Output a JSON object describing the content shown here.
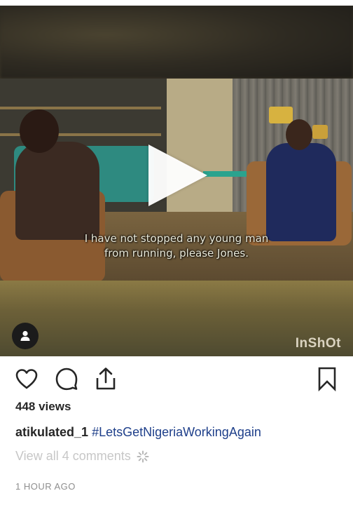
{
  "post": {
    "video": {
      "subtitle_line1": "I have not stopped any young man",
      "subtitle_line2": "from running, please Jones.",
      "watermark": "InShOt"
    },
    "views": "448 views",
    "caption": {
      "username": "atikulated_1",
      "hashtag": "#LetsGetNigeriaWorkingAgain"
    },
    "comments_link": "View all 4 comments",
    "timestamp": "1 HOUR AGO"
  },
  "icons": {
    "like": "heart-icon",
    "comment": "comment-bubble-icon",
    "share": "share-upload-icon",
    "save": "bookmark-icon",
    "play": "play-icon",
    "avatar": "user-silhouette-icon",
    "loading": "loading-spinner-icon"
  },
  "colors": {
    "text": "#262626",
    "hashtag": "#1e3f8a",
    "muted": "#c7c7c7",
    "timestamp": "#8e8e8e"
  }
}
